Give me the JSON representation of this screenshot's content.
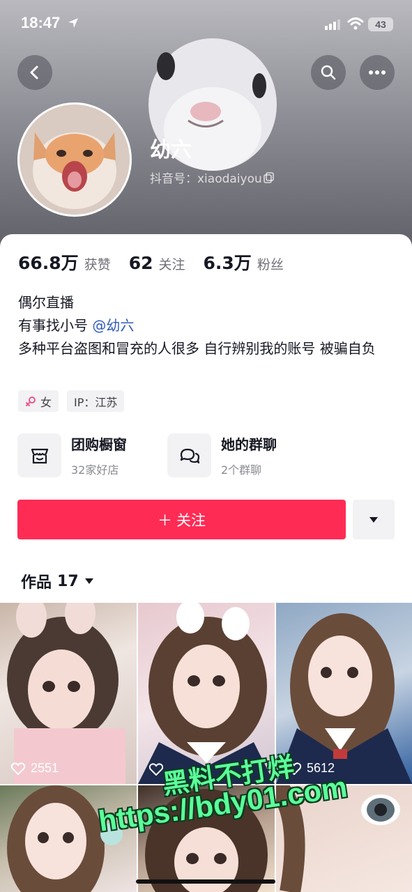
{
  "status_bar": {
    "time": "18:47",
    "battery": "43",
    "icons": [
      "location-arrow-icon",
      "signal-icon",
      "wifi-icon",
      "battery-icon"
    ]
  },
  "header": {
    "back_icon": "chevron-left-icon",
    "search_icon": "search-icon",
    "more_icon": "more-dots-icon"
  },
  "profile": {
    "nickname": "幼六",
    "douyin_id": "抖音号：xiaodaiyou",
    "copy_icon": "copy-icon"
  },
  "stats": [
    {
      "value": "66.8万",
      "label": "获赞"
    },
    {
      "value": "62",
      "label": "关注"
    },
    {
      "value": "6.3万",
      "label": "粉丝"
    }
  ],
  "bio": {
    "line1": "偶尔直播",
    "line2_prefix": "有事找小号",
    "line2_mention": "@幼六",
    "line3": "多种平台盗图和冒充的人很多 自行辨别我的账号 被骗自负"
  },
  "tags": {
    "gender": "女",
    "ip": "IP：江苏"
  },
  "features": [
    {
      "title": "团购橱窗",
      "sub": "32家好店",
      "icon": "shop-icon"
    },
    {
      "title": "她的群聊",
      "sub": "2个群聊",
      "icon": "chat-bubbles-icon"
    }
  ],
  "actions": {
    "follow_label": "关注",
    "follow_prefix": "＋",
    "dropdown_icon": "caret-down-icon"
  },
  "works": {
    "label": "作品",
    "count": "17"
  },
  "thumbnails": [
    {
      "likes": "2551"
    },
    {
      "likes": ""
    },
    {
      "likes": "5612"
    },
    {
      "likes": ""
    },
    {
      "likes": ""
    },
    {
      "likes": ""
    }
  ],
  "watermark": {
    "line1": "黑料不打烊",
    "line2": "https://bdy01.com"
  },
  "colors": {
    "accent": "#fe2c55",
    "mention": "#2f5bb7",
    "watermark": "#5bff9a"
  }
}
